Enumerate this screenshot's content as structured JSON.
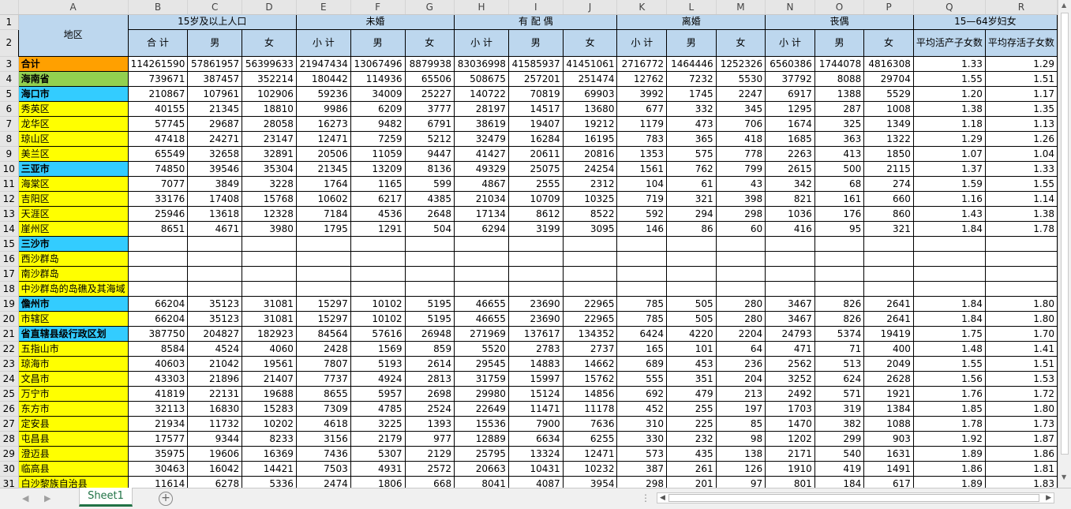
{
  "columns": [
    "A",
    "B",
    "C",
    "D",
    "E",
    "F",
    "G",
    "H",
    "I",
    "J",
    "K",
    "L",
    "M",
    "N",
    "O",
    "P",
    "Q",
    "R"
  ],
  "headers": {
    "region": "地区",
    "group_total": "15岁及以上人口",
    "group_unmarried": "未婚",
    "group_married": "有 配 偶",
    "group_divorced": "离婚",
    "group_widowed": "丧偶",
    "group_women": "15—64岁妇女",
    "sub_total": "合 计",
    "sub_subtotal": "小 计",
    "male": "男",
    "female": "女",
    "avg_born": "平均活产子女数",
    "avg_alive": "平均存活子女数"
  },
  "rows": [
    {
      "num": "3",
      "name": "合计",
      "color": "orange",
      "bold": true,
      "vals": [
        "114261590",
        "57861957",
        "56399633",
        "21947434",
        "13067496",
        "8879938",
        "83036998",
        "41585937",
        "41451061",
        "2716772",
        "1464446",
        "1252326",
        "6560386",
        "1744078",
        "4816308",
        "1.33",
        "1.29"
      ]
    },
    {
      "num": "4",
      "name": "海南省",
      "color": "green",
      "bold": true,
      "vals": [
        "739671",
        "387457",
        "352214",
        "180442",
        "114936",
        "65506",
        "508675",
        "257201",
        "251474",
        "12762",
        "7232",
        "5530",
        "37792",
        "8088",
        "29704",
        "1.55",
        "1.51"
      ]
    },
    {
      "num": "5",
      "name": "海口市",
      "color": "cyan",
      "bold": true,
      "vals": [
        "210867",
        "107961",
        "102906",
        "59236",
        "34009",
        "25227",
        "140722",
        "70819",
        "69903",
        "3992",
        "1745",
        "2247",
        "6917",
        "1388",
        "5529",
        "1.20",
        "1.17"
      ]
    },
    {
      "num": "6",
      "name": "秀英区",
      "color": "yellow",
      "bold": false,
      "vals": [
        "40155",
        "21345",
        "18810",
        "9986",
        "6209",
        "3777",
        "28197",
        "14517",
        "13680",
        "677",
        "332",
        "345",
        "1295",
        "287",
        "1008",
        "1.38",
        "1.35"
      ]
    },
    {
      "num": "7",
      "name": "龙华区",
      "color": "yellow",
      "bold": false,
      "vals": [
        "57745",
        "29687",
        "28058",
        "16273",
        "9482",
        "6791",
        "38619",
        "19407",
        "19212",
        "1179",
        "473",
        "706",
        "1674",
        "325",
        "1349",
        "1.18",
        "1.13"
      ]
    },
    {
      "num": "8",
      "name": "琼山区",
      "color": "yellow",
      "bold": false,
      "vals": [
        "47418",
        "24271",
        "23147",
        "12471",
        "7259",
        "5212",
        "32479",
        "16284",
        "16195",
        "783",
        "365",
        "418",
        "1685",
        "363",
        "1322",
        "1.29",
        "1.26"
      ]
    },
    {
      "num": "9",
      "name": "美兰区",
      "color": "yellow",
      "bold": false,
      "vals": [
        "65549",
        "32658",
        "32891",
        "20506",
        "11059",
        "9447",
        "41427",
        "20611",
        "20816",
        "1353",
        "575",
        "778",
        "2263",
        "413",
        "1850",
        "1.07",
        "1.04"
      ]
    },
    {
      "num": "10",
      "name": "三亚市",
      "color": "cyan",
      "bold": true,
      "vals": [
        "74850",
        "39546",
        "35304",
        "21345",
        "13209",
        "8136",
        "49329",
        "25075",
        "24254",
        "1561",
        "762",
        "799",
        "2615",
        "500",
        "2115",
        "1.37",
        "1.33"
      ]
    },
    {
      "num": "11",
      "name": "海棠区",
      "color": "yellow",
      "bold": false,
      "vals": [
        "7077",
        "3849",
        "3228",
        "1764",
        "1165",
        "599",
        "4867",
        "2555",
        "2312",
        "104",
        "61",
        "43",
        "342",
        "68",
        "274",
        "1.59",
        "1.55"
      ]
    },
    {
      "num": "12",
      "name": "吉阳区",
      "color": "yellow",
      "bold": false,
      "vals": [
        "33176",
        "17408",
        "15768",
        "10602",
        "6217",
        "4385",
        "21034",
        "10709",
        "10325",
        "719",
        "321",
        "398",
        "821",
        "161",
        "660",
        "1.16",
        "1.14"
      ]
    },
    {
      "num": "13",
      "name": "天涯区",
      "color": "yellow",
      "bold": false,
      "vals": [
        "25946",
        "13618",
        "12328",
        "7184",
        "4536",
        "2648",
        "17134",
        "8612",
        "8522",
        "592",
        "294",
        "298",
        "1036",
        "176",
        "860",
        "1.43",
        "1.38"
      ]
    },
    {
      "num": "14",
      "name": "崖州区",
      "color": "yellow",
      "bold": false,
      "vals": [
        "8651",
        "4671",
        "3980",
        "1795",
        "1291",
        "504",
        "6294",
        "3199",
        "3095",
        "146",
        "86",
        "60",
        "416",
        "95",
        "321",
        "1.84",
        "1.78"
      ]
    },
    {
      "num": "15",
      "name": "三沙市",
      "color": "cyan",
      "bold": true,
      "vals": [
        "",
        "",
        "",
        "",
        "",
        "",
        "",
        "",
        "",
        "",
        "",
        "",
        "",
        "",
        "",
        "",
        ""
      ]
    },
    {
      "num": "16",
      "name": "西沙群岛",
      "color": "yellow",
      "bold": false,
      "vals": [
        "",
        "",
        "",
        "",
        "",
        "",
        "",
        "",
        "",
        "",
        "",
        "",
        "",
        "",
        "",
        "",
        ""
      ]
    },
    {
      "num": "17",
      "name": "南沙群岛",
      "color": "yellow",
      "bold": false,
      "vals": [
        "",
        "",
        "",
        "",
        "",
        "",
        "",
        "",
        "",
        "",
        "",
        "",
        "",
        "",
        "",
        "",
        ""
      ]
    },
    {
      "num": "18",
      "name": "中沙群岛的岛礁及其海域",
      "color": "yellow",
      "bold": false,
      "overflow": true,
      "vals": [
        "",
        "",
        "",
        "",
        "",
        "",
        "",
        "",
        "",
        "",
        "",
        "",
        "",
        "",
        "",
        "",
        ""
      ]
    },
    {
      "num": "19",
      "name": "儋州市",
      "color": "cyan",
      "bold": true,
      "vals": [
        "66204",
        "35123",
        "31081",
        "15297",
        "10102",
        "5195",
        "46655",
        "23690",
        "22965",
        "785",
        "505",
        "280",
        "3467",
        "826",
        "2641",
        "1.84",
        "1.80"
      ]
    },
    {
      "num": "20",
      "name": "市辖区",
      "color": "yellow",
      "bold": false,
      "vals": [
        "66204",
        "35123",
        "31081",
        "15297",
        "10102",
        "5195",
        "46655",
        "23690",
        "22965",
        "785",
        "505",
        "280",
        "3467",
        "826",
        "2641",
        "1.84",
        "1.80"
      ]
    },
    {
      "num": "21",
      "name": "省直辖县级行政区划",
      "color": "cyan",
      "bold": true,
      "vals": [
        "387750",
        "204827",
        "182923",
        "84564",
        "57616",
        "26948",
        "271969",
        "137617",
        "134352",
        "6424",
        "4220",
        "2204",
        "24793",
        "5374",
        "19419",
        "1.75",
        "1.70"
      ]
    },
    {
      "num": "22",
      "name": "五指山市",
      "color": "yellow",
      "bold": false,
      "vals": [
        "8584",
        "4524",
        "4060",
        "2428",
        "1569",
        "859",
        "5520",
        "2783",
        "2737",
        "165",
        "101",
        "64",
        "471",
        "71",
        "400",
        "1.48",
        "1.41"
      ]
    },
    {
      "num": "23",
      "name": "琼海市",
      "color": "yellow",
      "bold": false,
      "vals": [
        "40603",
        "21042",
        "19561",
        "7807",
        "5193",
        "2614",
        "29545",
        "14883",
        "14662",
        "689",
        "453",
        "236",
        "2562",
        "513",
        "2049",
        "1.55",
        "1.51"
      ]
    },
    {
      "num": "24",
      "name": "文昌市",
      "color": "yellow",
      "bold": false,
      "vals": [
        "43303",
        "21896",
        "21407",
        "7737",
        "4924",
        "2813",
        "31759",
        "15997",
        "15762",
        "555",
        "351",
        "204",
        "3252",
        "624",
        "2628",
        "1.56",
        "1.53"
      ]
    },
    {
      "num": "25",
      "name": "万宁市",
      "color": "yellow",
      "bold": false,
      "vals": [
        "41819",
        "22131",
        "19688",
        "8655",
        "5957",
        "2698",
        "29980",
        "15124",
        "14856",
        "692",
        "479",
        "213",
        "2492",
        "571",
        "1921",
        "1.76",
        "1.72"
      ]
    },
    {
      "num": "26",
      "name": "东方市",
      "color": "yellow",
      "bold": false,
      "vals": [
        "32113",
        "16830",
        "15283",
        "7309",
        "4785",
        "2524",
        "22649",
        "11471",
        "11178",
        "452",
        "255",
        "197",
        "1703",
        "319",
        "1384",
        "1.85",
        "1.80"
      ]
    },
    {
      "num": "27",
      "name": "定安县",
      "color": "yellow",
      "bold": false,
      "vals": [
        "21934",
        "11732",
        "10202",
        "4618",
        "3225",
        "1393",
        "15536",
        "7900",
        "7636",
        "310",
        "225",
        "85",
        "1470",
        "382",
        "1088",
        "1.78",
        "1.73"
      ]
    },
    {
      "num": "28",
      "name": "屯昌县",
      "color": "yellow",
      "bold": false,
      "vals": [
        "17577",
        "9344",
        "8233",
        "3156",
        "2179",
        "977",
        "12889",
        "6634",
        "6255",
        "330",
        "232",
        "98",
        "1202",
        "299",
        "903",
        "1.92",
        "1.87"
      ]
    },
    {
      "num": "29",
      "name": "澄迈县",
      "color": "yellow",
      "bold": false,
      "vals": [
        "35975",
        "19606",
        "16369",
        "7436",
        "5307",
        "2129",
        "25795",
        "13324",
        "12471",
        "573",
        "435",
        "138",
        "2171",
        "540",
        "1631",
        "1.89",
        "1.86"
      ]
    },
    {
      "num": "30",
      "name": "临高县",
      "color": "yellow",
      "bold": false,
      "vals": [
        "30463",
        "16042",
        "14421",
        "7503",
        "4931",
        "2572",
        "20663",
        "10431",
        "10232",
        "387",
        "261",
        "126",
        "1910",
        "419",
        "1491",
        "1.86",
        "1.81"
      ]
    },
    {
      "num": "31",
      "name": "白沙黎族自治县",
      "color": "yellow",
      "bold": false,
      "vals": [
        "11614",
        "6278",
        "5336",
        "2474",
        "1806",
        "668",
        "8041",
        "4087",
        "3954",
        "298",
        "201",
        "97",
        "801",
        "184",
        "617",
        "1.89",
        "1.83"
      ]
    }
  ],
  "tab": {
    "sheet_name": "Sheet1",
    "add_symbol": "+"
  },
  "icons": {
    "nav_prev": "◀",
    "nav_next": "▶",
    "dots": "⋮",
    "scroll_left": "◀",
    "scroll_right": "▶",
    "scroll_up": "▲",
    "scroll_down": "▼"
  },
  "colors": {
    "orange": "#ffa000",
    "green": "#92d050",
    "cyan": "#33ccff",
    "yellow": "#ffff00",
    "header_blue": "#bdd7ee",
    "tab_green": "#217346"
  }
}
